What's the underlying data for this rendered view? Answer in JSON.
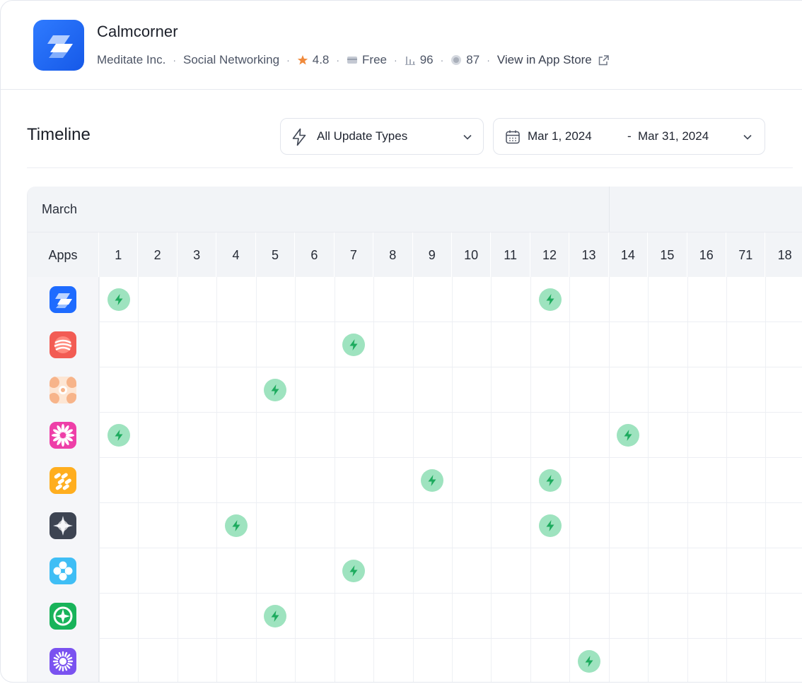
{
  "app": {
    "name": "Calmcorner",
    "developer": "Meditate Inc.",
    "category": "Social Networking",
    "rating": "4.8",
    "price": "Free",
    "rank": "96",
    "score": "87",
    "store_link": "View in App Store",
    "brand_color": "#1e6bff"
  },
  "toolbar": {
    "title": "Timeline",
    "update_type": "All Update Types",
    "date_from": "Mar 1, 2024",
    "date_separator": "-",
    "date_to": "Mar 31, 2024"
  },
  "table": {
    "month": "March",
    "apps_header": "Apps",
    "days": [
      "1",
      "2",
      "3",
      "4",
      "5",
      "6",
      "7",
      "8",
      "9",
      "10",
      "11",
      "12",
      "13",
      "14",
      "15",
      "16",
      "71",
      "18"
    ],
    "update_color": "#9ee3bf",
    "update_icon_color": "#1dab5e",
    "rows": [
      {
        "icon": "calmcorner-logo-icon",
        "color": "#1e6bff",
        "updates": [
          1,
          12
        ]
      },
      {
        "icon": "red-waves-icon",
        "color": "#f25c54",
        "updates": [
          7
        ]
      },
      {
        "icon": "peach-circles-icon",
        "color": "#f7b48a",
        "updates": [
          5
        ]
      },
      {
        "icon": "pink-flower-icon",
        "color": "#ee3fa8",
        "updates": [
          1,
          14
        ]
      },
      {
        "icon": "orange-pills-icon",
        "color": "#ffae1f",
        "updates": [
          9,
          12
        ]
      },
      {
        "icon": "star-burst-icon",
        "color": "#3d4452",
        "updates": [
          4,
          12
        ]
      },
      {
        "icon": "blue-clover-icon",
        "color": "#3fbef5",
        "updates": [
          7
        ]
      },
      {
        "icon": "green-compass-icon",
        "color": "#18b35a",
        "updates": [
          5
        ]
      },
      {
        "icon": "purple-sun-icon",
        "color": "#7a52f0",
        "updates": [
          13
        ]
      }
    ]
  }
}
